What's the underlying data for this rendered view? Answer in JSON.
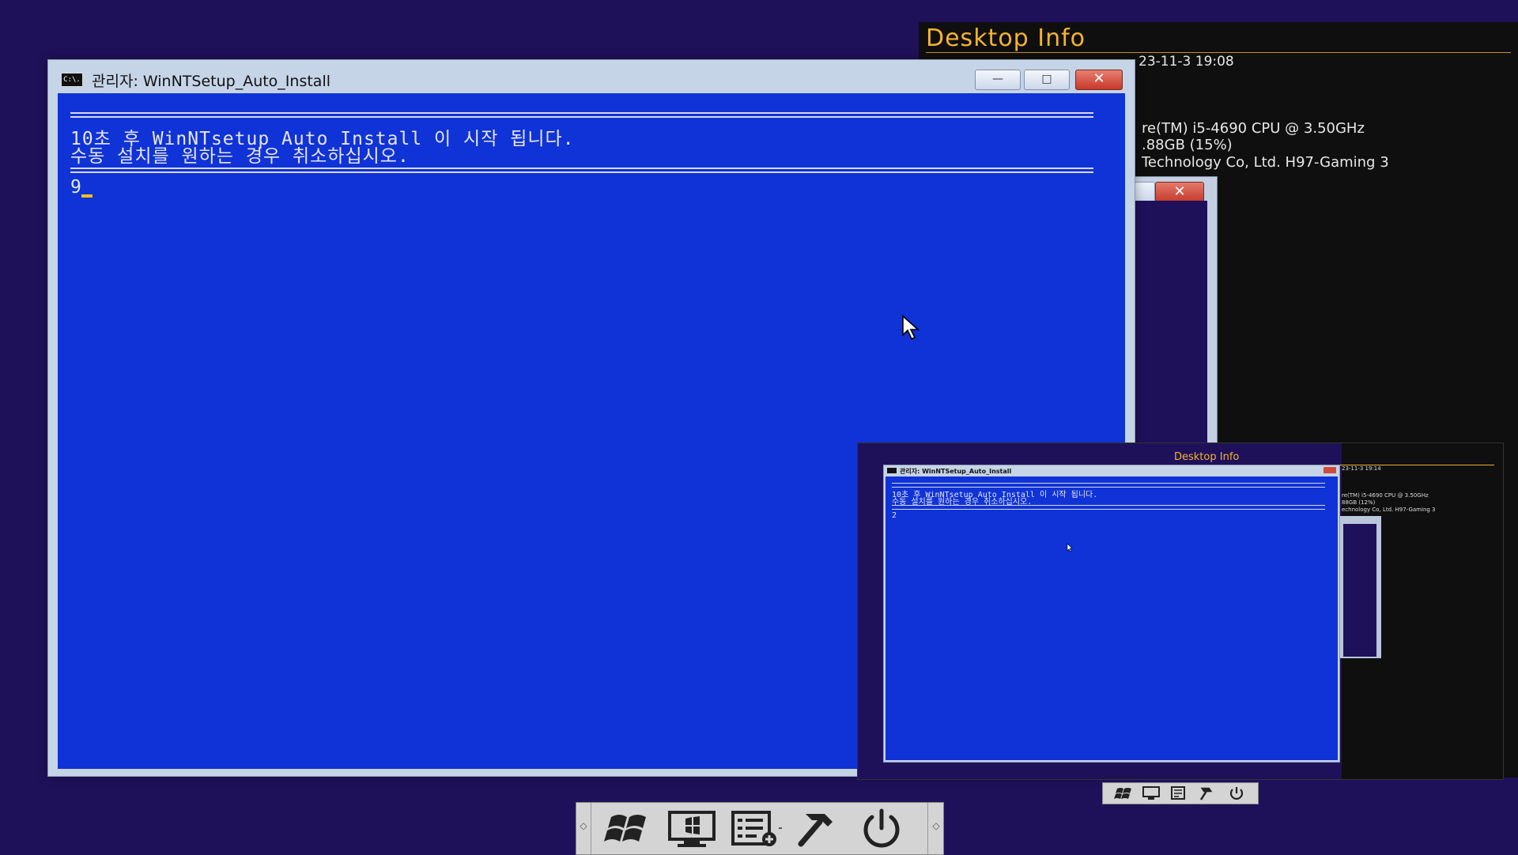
{
  "desktop_info": {
    "title": "Desktop Info",
    "lines": [
      "23-11-3 19:08",
      "re(TM) i5-4690 CPU @ 3.50GHz",
      ".88GB (15%)",
      "Technology Co, Ltd. H97-Gaming 3"
    ]
  },
  "cmd_window": {
    "title": "관리자:  WinNTSetup_Auto_Install",
    "icon_label": "C:\\.",
    "minimize_label": "—",
    "maximize_label": "□",
    "close_label": "✕",
    "console_lines": [
      "10초 후 WinNTsetup Auto Install 이 시작 됩니다.",
      "수동 설치를 원하는 경우 취소하십시오."
    ],
    "countdown": "9"
  },
  "back_window": {
    "close_label": "✕"
  },
  "taskbar": {
    "icons": [
      "windows-start-icon",
      "monitor-icon",
      "task-list-icon",
      "hammer-icon",
      "power-icon"
    ],
    "left_arrow": "◇",
    "right_arrow": "◇"
  },
  "thumbnail": {
    "desktop_info_title": "Desktop Info",
    "desktop_info_lines": [
      "23-11-3 19:14",
      "re(TM) i5-4690 CPU @ 3.50GHz",
      "88GB (12%)",
      "echnology Co, Ltd. H97-Gaming 3"
    ],
    "cmd_title": "관리자:  WinNTSetup_Auto_Install",
    "console_lines": [
      "10초 후 WinNTsetup Auto Install 이 시작 됩니다.",
      "수동 설치를 원하는 경우 취소하십시오."
    ],
    "countdown": "2"
  }
}
